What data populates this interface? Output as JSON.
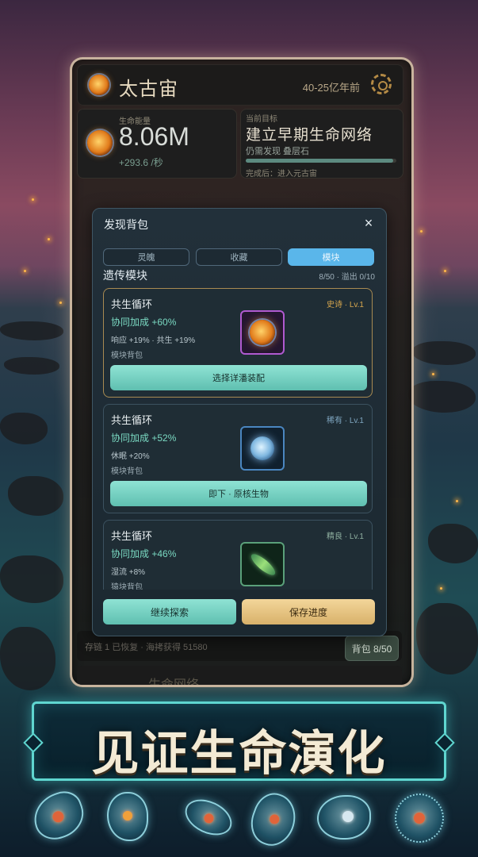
{
  "game": {
    "era_title": "太古宙",
    "era_range": "40-25亿年前",
    "energy": {
      "label": "生命能量",
      "value": "8.06M",
      "rate": "+293.6 /秒"
    },
    "goal": {
      "label": "当前目标",
      "title": "建立早期生命网络",
      "subtitle": "仍需发现 叠层石",
      "after": "完成后：进入元古宙",
      "progress": 0.98
    },
    "log_text": "存链 1 已恢复 · 海拷获得 51580",
    "bag_button": "背包 8/50",
    "bottom_partial": "生命网络"
  },
  "modal": {
    "title": "发现背包",
    "close": "×",
    "tabs": [
      "灵魄",
      "收藏",
      "模块"
    ],
    "active_tab": 2,
    "section_title": "遗传模块",
    "section_count": "8/50 · 溢出 0/10",
    "cards": [
      {
        "name": "共生循环",
        "rarity": "史诗 · Lv.1",
        "rarity_color": "#d9a84e",
        "synergy": "协同加成 +60%",
        "effects": "响应 +19% · 共生 +19%",
        "source": "模块背包",
        "action": "选择详潘装配",
        "image": "sun-organism-icon"
      },
      {
        "name": "共生循环",
        "rarity": "稀有 · Lv.1",
        "rarity_color": "#7fa6c0",
        "synergy": "协同加成 +52%",
        "effects": "休眠 +20%",
        "source": "模块背包",
        "action": "即下 · 原核生物",
        "image": "cell-orb-icon"
      },
      {
        "name": "共生循环",
        "rarity": "精良 · Lv.1",
        "rarity_color": "#8fb0a0",
        "synergy": "协同加成 +46%",
        "effects": "湿流 +8%",
        "source": "猿块背包",
        "action": "",
        "image": "euglena-icon"
      }
    ],
    "continue_button": "继续探索",
    "save_button": "保存进度"
  },
  "banner": {
    "text": "见证生命演化"
  }
}
